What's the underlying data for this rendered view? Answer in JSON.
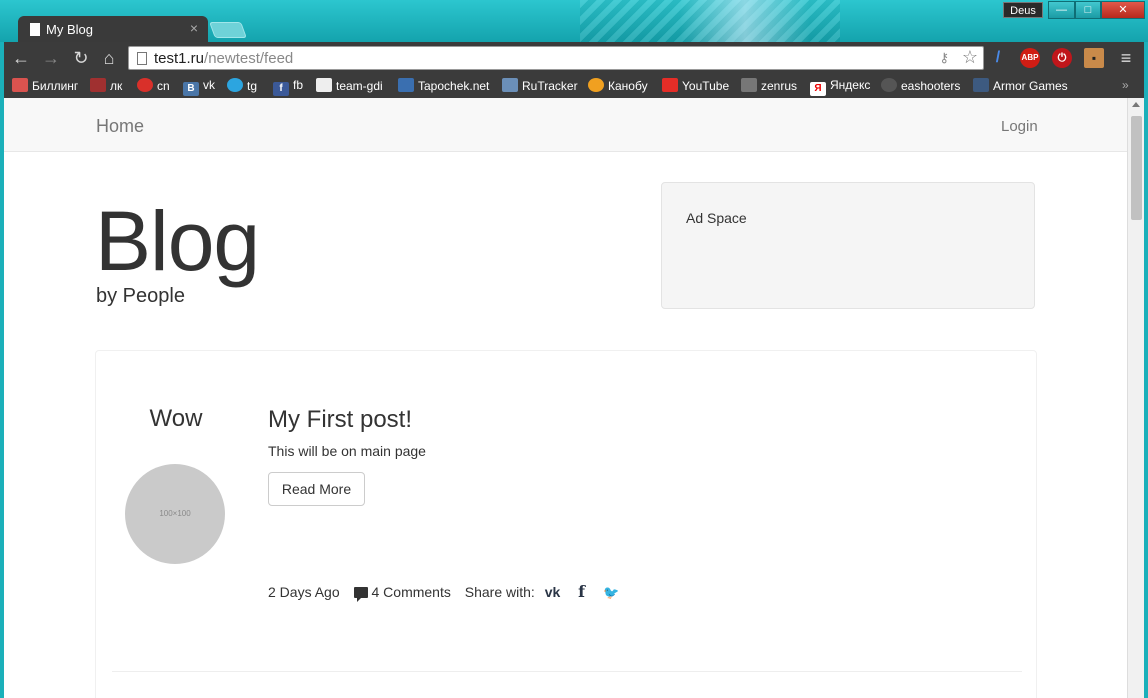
{
  "browser": {
    "tab_title": "My Blog",
    "tab_close": "×",
    "user_name": "Deus",
    "window_buttons": {
      "minimize": "—",
      "maximize": "□",
      "close": "✕"
    },
    "url_host": "test1.ru",
    "url_path": "/newtest/feed",
    "nav_icons": {
      "back": "←",
      "forward": "→",
      "reload": "↻",
      "home": "⌂"
    },
    "extensions": [
      {
        "name": "pen-extension",
        "label": "/",
        "color": "#3a6fd8"
      },
      {
        "name": "adblock-plus",
        "label": "ABP",
        "color": "#d01d14"
      },
      {
        "name": "ublock-extension",
        "label": "⏻",
        "color": "#c0161b"
      },
      {
        "name": "face-extension",
        "label": "▪",
        "color": "#c98a4a"
      },
      {
        "name": "menu-icon",
        "label": "≡",
        "color": "#3b3b3b"
      }
    ],
    "bookmarks": [
      {
        "label": "Биллинг",
        "icon": "billing-icon",
        "color": "#d9534f"
      },
      {
        "label": "лк",
        "icon": "lk-icon",
        "color": "#a03030"
      },
      {
        "label": "cn",
        "icon": "cn-icon",
        "color": "#d9302a"
      },
      {
        "label": "vk",
        "icon": "vk-icon",
        "color": "#4a76a8"
      },
      {
        "label": "tg",
        "icon": "telegram-icon",
        "color": "#2ca5e0"
      },
      {
        "label": "fb",
        "icon": "facebook-icon",
        "color": "#3b5998"
      },
      {
        "label": "team-gdi",
        "icon": "team-gdi-icon",
        "color": "#222222"
      },
      {
        "label": "Tapochek.net",
        "icon": "tapochek-icon",
        "color": "#3a6fb0"
      },
      {
        "label": "RuTracker",
        "icon": "rutracker-icon",
        "color": "#6b8fb8"
      },
      {
        "label": "Канобу",
        "icon": "kanobu-icon",
        "color": "#f0a020"
      },
      {
        "label": "YouTube",
        "icon": "youtube-icon",
        "color": "#e52d27"
      },
      {
        "label": "zenrus",
        "icon": "zenrus-icon",
        "color": "#777777"
      },
      {
        "label": "Яндекс",
        "icon": "yandex-icon",
        "color": "#ffffff"
      },
      {
        "label": "eashooters",
        "icon": "eashooters-icon",
        "color": "#555555"
      },
      {
        "label": "Armor Games",
        "icon": "armor-games-icon",
        "color": "#3d5a80"
      }
    ],
    "bookmarks_overflow": "»"
  },
  "page": {
    "nav_home": "Home",
    "nav_login": "Login",
    "blog_title": "Blog",
    "blog_subtitle": "by People",
    "ad_label": "Ad Space",
    "post": {
      "author": "Wow",
      "avatar_placeholder": "100×100",
      "title": "My First post!",
      "excerpt": "This will be on main page",
      "read_more": "Read More",
      "time_ago": "2 Days Ago",
      "comments": "4 Comments",
      "share_label": "Share with:",
      "share_icons": {
        "vk": "vk",
        "facebook": "f",
        "twitter": "🐦"
      }
    }
  }
}
